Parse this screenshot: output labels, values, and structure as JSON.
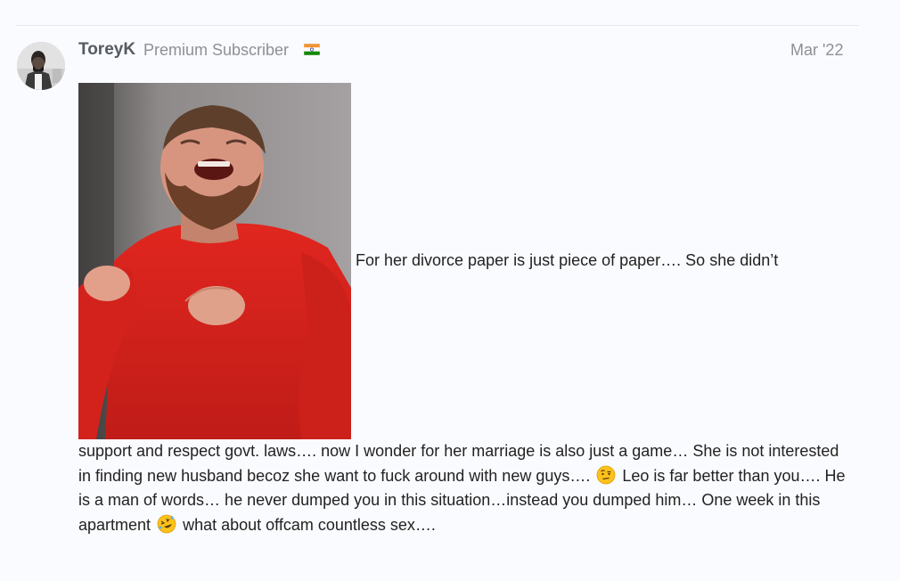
{
  "post": {
    "username": "ToreyK",
    "user_title": "Premium Subscriber",
    "flag_icon": "india-flag-icon",
    "date": "Mar '22",
    "image_icon": "laughing-man-gif",
    "text_inline": "For her divorce paper is just piece of paper…. So she didn’t",
    "text_part1": "support and respect govt. laws…. now I wonder for her marriage is also just a game… She is not interested in finding new husband becoz she want to fuck around with new guys….",
    "emoji1_icon": "face-with-raised-eyebrow-icon",
    "text_part2": "Leo is far better than you…. He is a man of words… he never dumped you in this situation…instead you dumped him… One week in this apartment",
    "emoji2_icon": "rolling-on-floor-laughing-icon",
    "text_part3": "what about offcam countless sex…."
  },
  "colors": {
    "background": "#fafbfe",
    "username": "#555b63",
    "meta": "#8c9096",
    "text": "#222222",
    "shirt": "#d8231f"
  }
}
